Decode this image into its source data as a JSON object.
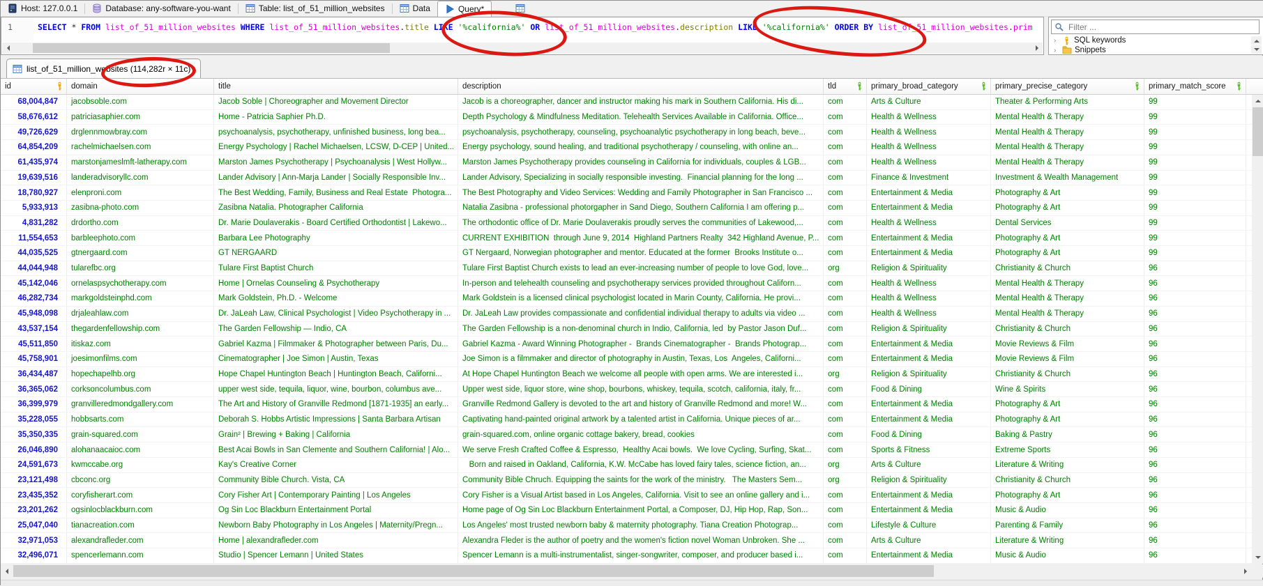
{
  "colors": {
    "sql_keyword": "#0000ee",
    "sql_table_name": "#dd00dd",
    "sql_column_name": "#808000",
    "sql_string": "#008000",
    "grid_number": "#1414d2",
    "grid_text": "#008000",
    "primary_key_gold": "#eda913",
    "index_key_green": "#55c41c",
    "annotation_red": "#dc1812"
  },
  "topbar": {
    "tabs": [
      {
        "icon": "host-server-icon",
        "label": "Host: 127.0.0.1",
        "active": false
      },
      {
        "icon": "database-icon",
        "label": "Database: any-software-you-want",
        "active": false
      },
      {
        "icon": "table-icon",
        "label": "Table: list_of_51_million_websites",
        "active": false
      },
      {
        "icon": "data-grid-icon",
        "label": "Data",
        "active": false
      },
      {
        "icon": "query-play-icon",
        "label": "Query*",
        "active": true
      }
    ]
  },
  "editor": {
    "line_number": "1",
    "sql_tokens": [
      [
        "kw",
        "SELECT"
      ],
      [
        "pl",
        " * "
      ],
      [
        "kw",
        "FROM"
      ],
      [
        "pl",
        " "
      ],
      [
        "tbl",
        "list_of_51_million_websites"
      ],
      [
        "pl",
        " "
      ],
      [
        "kw",
        "WHERE"
      ],
      [
        "pl",
        " "
      ],
      [
        "tbl",
        "list_of_51_million_websites"
      ],
      [
        "pl",
        "."
      ],
      [
        "col",
        "title"
      ],
      [
        "pl",
        " "
      ],
      [
        "kw",
        "LIKE"
      ],
      [
        "pl",
        " "
      ],
      [
        "str",
        "'%california%'"
      ],
      [
        "pl",
        " "
      ],
      [
        "kw",
        "OR"
      ],
      [
        "pl",
        " "
      ],
      [
        "tbl",
        "list_of_51_million_websites"
      ],
      [
        "pl",
        "."
      ],
      [
        "col",
        "description"
      ],
      [
        "pl",
        " "
      ],
      [
        "kw",
        "LIKE"
      ],
      [
        "pl",
        " "
      ],
      [
        "str",
        "'%california%'"
      ],
      [
        "pl",
        " "
      ],
      [
        "kw",
        "ORDER"
      ],
      [
        "pl",
        " "
      ],
      [
        "kw",
        "BY"
      ],
      [
        "pl",
        " "
      ],
      [
        "tbl",
        "list_of_51_million_websites"
      ],
      [
        "pl",
        "."
      ],
      [
        "tbl",
        "prim"
      ]
    ]
  },
  "side_panel": {
    "filter_placeholder": "Filter ...",
    "tree": [
      {
        "icon": "key-icon",
        "label": "SQL keywords"
      },
      {
        "icon": "folder-icon",
        "label": "Snippets"
      }
    ]
  },
  "result_tab": {
    "label": "list_of_51_million_websites (114,282r × 11c)"
  },
  "grid": {
    "columns": [
      {
        "name": "id",
        "key": "gold"
      },
      {
        "name": "domain",
        "key": null
      },
      {
        "name": "title",
        "key": null
      },
      {
        "name": "description",
        "key": null
      },
      {
        "name": "tld",
        "key": "green"
      },
      {
        "name": "primary_broad_category",
        "key": "green"
      },
      {
        "name": "primary_precise_category",
        "key": "green"
      },
      {
        "name": "primary_match_score",
        "key": "green"
      }
    ],
    "rows": [
      [
        "68,004,847",
        "jacobsoble.com",
        "Jacob Soble | Choreographer and Movement Director",
        "Jacob is a choreographer, dancer and instructor making his mark in Southern California. His di...",
        "com",
        "Arts & Culture",
        "Theater & Performing Arts",
        "99"
      ],
      [
        "58,676,612",
        "patriciasaphier.com",
        "Home - Patricia Saphier Ph.D.",
        "Depth Psychology & Mindfulness Meditation. Telehealth Services Available in California. Office...",
        "com",
        "Health & Wellness",
        "Mental Health & Therapy",
        "99"
      ],
      [
        "49,726,629",
        "drglennmowbray.com",
        "psychoanalysis, psychotherapy, unfinished business, long bea...",
        "psychoanalysis, psychotherapy, counseling, psychoanalytic psychotherapy in long beach, beve...",
        "com",
        "Health & Wellness",
        "Mental Health & Therapy",
        "99"
      ],
      [
        "64,854,209",
        "rachelmichaelsen.com",
        "Energy Psychology | Rachel Michaelsen, LCSW, D-CEP | United...",
        "Energy psychology, sound healing, and traditional psychotherapy / counseling, with online an...",
        "com",
        "Health & Wellness",
        "Mental Health & Therapy",
        "99"
      ],
      [
        "61,435,974",
        "marstonjameslmft-latherapy.com",
        "Marston James Psychotherapy | Psychoanalysis | West Hollyw...",
        "Marston James Psychotherapy provides counseling in California for individuals, couples & LGB...",
        "com",
        "Health & Wellness",
        "Mental Health & Therapy",
        "99"
      ],
      [
        "19,639,516",
        "landeradvisoryllc.com",
        "Lander Advisory | Ann-Marja Lander | Socially Responsible Inv...",
        "Lander Advisory, Specializing in socially responsible investing.  Financial planning for the long ...",
        "com",
        "Finance & Investment",
        "Investment & Wealth Management",
        "99"
      ],
      [
        "18,780,927",
        "elenproni.com",
        "The Best Wedding, Family, Business and Real Estate  Photogra...",
        "The Best Photography and Video Services: Wedding and Family Photographer in San Francisco ...",
        "com",
        "Entertainment & Media",
        "Photography & Art",
        "99"
      ],
      [
        "5,933,913",
        "zasibna-photo.com",
        "Zasibna Natalia. Photographer California",
        "Natalia Zasibna - professional photorgapher in Sand Diego, Southern California I am offering p...",
        "com",
        "Entertainment & Media",
        "Photography & Art",
        "99"
      ],
      [
        "4,831,282",
        "drdortho.com",
        "Dr. Marie Doulaverakis - Board Certified Orthodontist | Lakewo...",
        "The orthodontic office of Dr. Marie Doulaverakis proudly serves the communities of Lakewood,...",
        "com",
        "Health & Wellness",
        "Dental Services",
        "99"
      ],
      [
        "11,554,653",
        "barbleephoto.com",
        "Barbara Lee Photography",
        "CURRENT EXHIBITION  through June 9, 2014  Highland Partners Realty  342 Highland Avenue, P...",
        "com",
        "Entertainment & Media",
        "Photography & Art",
        "99"
      ],
      [
        "44,035,525",
        "gtnergaard.com",
        "GT NERGAARD",
        "GT Nergaard, Norwegian photographer and mentor. Educated at the former  Brooks Institute o...",
        "com",
        "Entertainment & Media",
        "Photography & Art",
        "99"
      ],
      [
        "44,044,948",
        "tularefbc.org",
        "Tulare First Baptist Church",
        "Tulare First Baptist Church exists to lead an ever-increasing number of people to love God, love...",
        "org",
        "Religion & Spirituality",
        "Christianity & Church",
        "96"
      ],
      [
        "45,142,046",
        "ornelaspsychotherapy.com",
        "Home | Ornelas Counseling & Psychotherapy",
        "In-person and telehealth counseling and psychotherapy services provided throughout Californ...",
        "com",
        "Health & Wellness",
        "Mental Health & Therapy",
        "96"
      ],
      [
        "46,282,734",
        "markgoldsteinphd.com",
        "Mark Goldstein, Ph.D. - Welcome",
        "Mark Goldstein is a licensed clinical psychologist located in Marin County, California. He provi...",
        "com",
        "Health & Wellness",
        "Mental Health & Therapy",
        "96"
      ],
      [
        "45,948,098",
        "drjaleahlaw.com",
        "Dr. JaLeah Law, Clinical Psychologist | Video Psychotherapy in ...",
        "Dr. JaLeah Law provides compassionate and confidential individual therapy to adults via video ...",
        "com",
        "Health & Wellness",
        "Mental Health & Therapy",
        "96"
      ],
      [
        "43,537,154",
        "thegardenfellowship.com",
        "The Garden Fellowship — Indio, CA",
        "The Garden Fellowship is a non-denominal church in Indio, California, led  by Pastor Jason Duf...",
        "com",
        "Religion & Spirituality",
        "Christianity & Church",
        "96"
      ],
      [
        "45,511,850",
        "itiskaz.com",
        "Gabriel Kazma | Filmmaker & Photographer between Paris, Du...",
        "Gabriel Kazma - Award Winning Photographer -  Brands Cinematographer -  Brands Photograp...",
        "com",
        "Entertainment & Media",
        "Movie Reviews & Film",
        "96"
      ],
      [
        "45,758,901",
        "joesimonfilms.com",
        "Cinematographer | Joe Simon | Austin, Texas",
        "Joe Simon is a filmmaker and director of photography in Austin, Texas, Los  Angeles, Californi...",
        "com",
        "Entertainment & Media",
        "Movie Reviews & Film",
        "96"
      ],
      [
        "36,434,487",
        "hopechapelhb.org",
        "Hope Chapel Huntington Beach | Huntington Beach, Californi...",
        "At Hope Chapel Huntington Beach we welcome all people with open arms. We are interested i...",
        "org",
        "Religion & Spirituality",
        "Christianity & Church",
        "96"
      ],
      [
        "36,365,062",
        "corksoncolumbus.com",
        "upper west side, tequila, liquor, wine, bourbon, columbus ave...",
        "Upper west side, liquor store, wine shop, bourbons, whiskey, tequila, scotch, california, italy, fr...",
        "com",
        "Food & Dining",
        "Wine & Spirits",
        "96"
      ],
      [
        "36,399,979",
        "granvilleredmondgallery.com",
        "The Art and History of Granville Redmond [1871-1935] an early...",
        "Granville Redmond Gallery is devoted to the art and history of Granville Redmond and more! W...",
        "com",
        "Entertainment & Media",
        "Photography & Art",
        "96"
      ],
      [
        "35,228,055",
        "hobbsarts.com",
        "Deborah S. Hobbs Artistic Impressions | Santa Barbara Artisan",
        "Captivating hand-painted original artwork by a talented artist in California. Unique pieces of ar...",
        "com",
        "Entertainment & Media",
        "Photography & Art",
        "96"
      ],
      [
        "35,350,335",
        "grain-squared.com",
        "Grain² | Brewing + Baking | California",
        "grain-squared.com, online organic cottage bakery, bread, cookies",
        "com",
        "Food & Dining",
        "Baking & Pastry",
        "96"
      ],
      [
        "26,046,890",
        "alohanaacaioc.com",
        "Best Acai Bowls in San Clemente and Southern California! | Alo...",
        "We serve Fresh Crafted Coffee & Espresso,  Healthy Acai bowls.  We love Cycling, Surfing, Skat...",
        "com",
        "Sports & Fitness",
        "Extreme Sports",
        "96"
      ],
      [
        "24,591,673",
        "kwmccabe.org",
        "Kay's Creative Corner",
        "   Born and raised in Oakland, California, K.W. McCabe has loved fairy tales, science fiction, an...",
        "org",
        "Arts & Culture",
        "Literature & Writing",
        "96"
      ],
      [
        "23,121,498",
        "cbconc.org",
        "Community Bible Church. Vista, CA",
        "Community Bible Chruch. Equipping the saints for the work of the ministry.   The Masters Sem...",
        "org",
        "Religion & Spirituality",
        "Christianity & Church",
        "96"
      ],
      [
        "23,435,352",
        "coryfisherart.com",
        "Cory Fisher Art | Contemporary Painting | Los Angeles",
        "Cory Fisher is a Visual Artist based in Los Angeles, California. Visit to see an online gallery and i...",
        "com",
        "Entertainment & Media",
        "Photography & Art",
        "96"
      ],
      [
        "23,201,262",
        "ogsinlocblackburn.com",
        "Og Sin Loc Blackburn Entertainment Portal",
        "Home page of Og Sin Loc Blackburn Entertainment Portal, a Composer, DJ, Hip Hop, Rap, Son...",
        "com",
        "Entertainment & Media",
        "Music & Audio",
        "96"
      ],
      [
        "25,047,040",
        "tianacreation.com",
        "Newborn Baby Photography in Los Angeles | Maternity/Pregn...",
        "Los Angeles' most trusted newborn baby & maternity photography. Tiana Creation Photograp...",
        "com",
        "Lifestyle & Culture",
        "Parenting & Family",
        "96"
      ],
      [
        "32,971,053",
        "alexandrafleder.com",
        "Home | alexandrafleder.com",
        "Alexandra Fleder is the author of poetry and the women's fiction novel Woman Unbroken. She ...",
        "com",
        "Arts & Culture",
        "Literature & Writing",
        "96"
      ],
      [
        "32,496,071",
        "spencerlemann.com",
        "Studio | Spencer Lemann | United States",
        "Spencer Lemann is a multi-instrumentalist, singer-songwriter, composer, and producer based i...",
        "com",
        "Entertainment & Media",
        "Music & Audio",
        "96"
      ]
    ]
  }
}
